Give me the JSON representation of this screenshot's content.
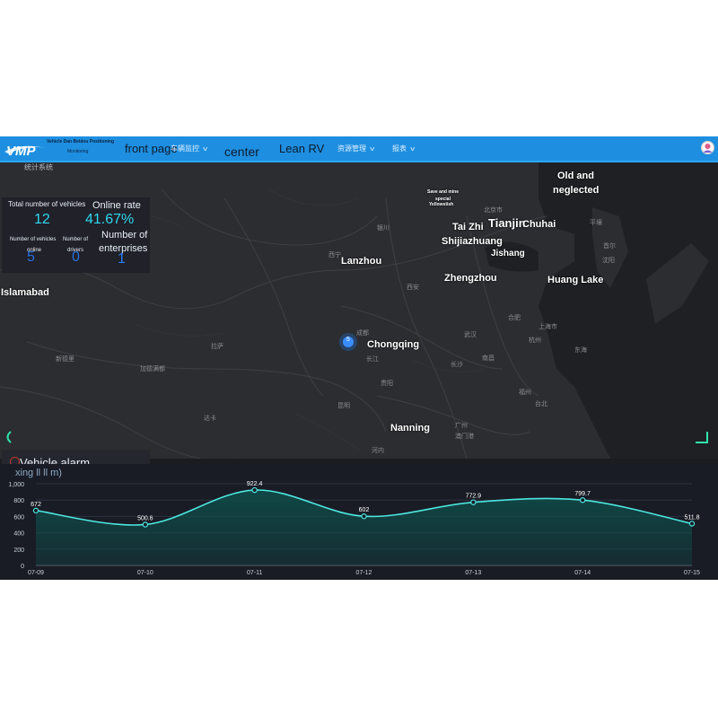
{
  "header": {
    "logo_text": "VMP",
    "logo_sub1": "Vehicle Dan Beidou Positioning",
    "logo_sub2": "Monitoring",
    "nav": [
      {
        "label": "front page",
        "dropdown": false
      },
      {
        "label": "车辆监控",
        "dropdown": true
      },
      {
        "label": "center",
        "dropdown": false
      },
      {
        "label": "Lean RV",
        "dropdown": false
      },
      {
        "label": "资源管理",
        "dropdown": true
      },
      {
        "label": "报表",
        "dropdown": true
      }
    ]
  },
  "map": {
    "corner_label": "统计系统",
    "cities": [
      {
        "name": "Old and"
      },
      {
        "name": "neglected"
      },
      {
        "name": "Save and mine"
      },
      {
        "name": "special"
      },
      {
        "name": "Yellowstish"
      },
      {
        "name": "Tai Zhi"
      },
      {
        "name": "Tianjin"
      },
      {
        "name": "Chuhai"
      },
      {
        "name": "Shijiazhuang"
      },
      {
        "name": "Jishang"
      },
      {
        "name": "Lanzhou"
      },
      {
        "name": "Islamabad"
      },
      {
        "name": "Zhengzhou"
      },
      {
        "name": "Huang Lake"
      },
      {
        "name": "Chongqing"
      },
      {
        "name": "Nanning"
      }
    ],
    "base_labels": [
      "北京市",
      "西宁",
      "银川",
      "西安",
      "成都",
      "长江",
      "武汉",
      "长沙",
      "合肥",
      "上海市",
      "杭州",
      "南昌",
      "福州",
      "台北",
      "贵阳",
      "昆明",
      "广州",
      "澳门港",
      "河内",
      "拉萨",
      "加德满都",
      "新德里",
      "达卡",
      "东海",
      "首尔",
      "平壤",
      "沈阳"
    ],
    "marker_count": "5"
  },
  "stats": {
    "total_label": "Total number of vehicles",
    "total_value": "12",
    "rate_label": "Online rate",
    "rate_value": "41.67%",
    "online_label_1": "Number of vehicles",
    "online_label_2": "online",
    "online_value": "5",
    "drivers_label_1": "Number of",
    "drivers_label_2": "drivers",
    "drivers_value": "0",
    "ent_label_1": "Number of",
    "ent_label_2": "enterprises",
    "ent_value": "1"
  },
  "alarm": {
    "label": "Vehicle alarm"
  },
  "chart_data": {
    "type": "area",
    "title": "xing ll ll m)",
    "x": [
      "07-09",
      "07-10",
      "07-11",
      "07-12",
      "07-13",
      "07-14",
      "07-15"
    ],
    "series": [
      {
        "values": [
          672,
          500.6,
          922.4,
          602,
          772.9,
          799.7,
          511.8
        ]
      }
    ],
    "data_labels": [
      "672",
      "500.6",
      "922.4",
      "602",
      "772.9",
      "799.7",
      "511.8"
    ],
    "y_ticks": [
      "0",
      "200",
      "400",
      "600",
      "800",
      "1,000"
    ],
    "ylim": [
      0,
      1000
    ],
    "grid": true,
    "colors": {
      "line": "#4ee6e0",
      "fill": "#0f4a48"
    }
  }
}
